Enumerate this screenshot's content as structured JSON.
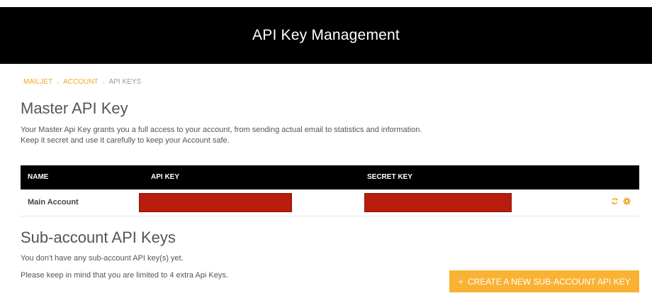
{
  "header": {
    "title": "API Key Management"
  },
  "breadcrumb": {
    "items": [
      {
        "label": "MAILJET"
      },
      {
        "label": "ACCOUNT"
      },
      {
        "label": "API KEYS"
      }
    ],
    "separator": "›"
  },
  "master": {
    "title": "Master API Key",
    "description_line1": "Your Master Api Key grants you a full access to your account, from sending actual email to statistics and information.",
    "description_line2": "Keep it secret and use it carefully to keep your Account safe."
  },
  "table": {
    "headers": {
      "name": "NAME",
      "api_key": "API KEY",
      "secret_key": "SECRET KEY"
    },
    "rows": [
      {
        "name": "Main Account"
      }
    ],
    "icons": {
      "regenerate": "refresh-icon",
      "settings": "gear-icon"
    }
  },
  "sub_accounts": {
    "title": "Sub-account API Keys",
    "empty_text": "You don't have any sub-account API key(s) yet.",
    "limit_text": "Please keep in mind that you are limited to 4 extra Api Keys.",
    "create_label": "CREATE A NEW SUB-ACCOUNT API KEY",
    "create_icon": "+"
  },
  "colors": {
    "accent": "#f9b233",
    "redaction": "#b71c0c",
    "header_bg": "#000000"
  }
}
